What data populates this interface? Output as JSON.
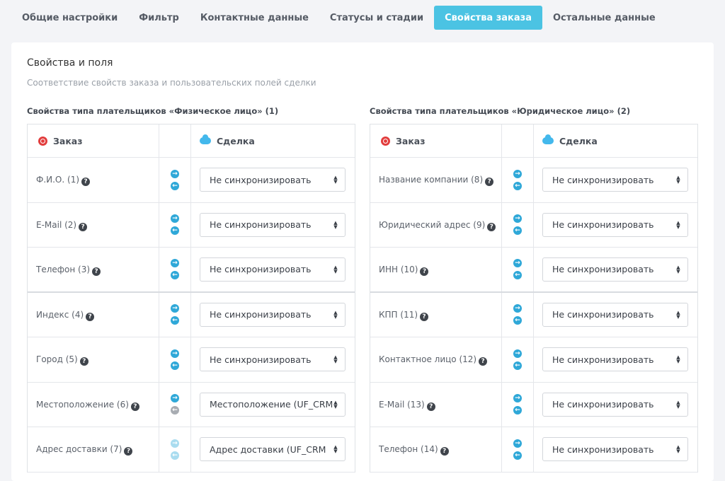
{
  "tabs": [
    {
      "label": "Общие настройки",
      "active": false
    },
    {
      "label": "Фильтр",
      "active": false
    },
    {
      "label": "Контактные данные",
      "active": false
    },
    {
      "label": "Статусы и стадии",
      "active": false
    },
    {
      "label": "Свойства заказа",
      "active": true
    },
    {
      "label": "Остальные данные",
      "active": false
    }
  ],
  "card": {
    "title": "Свойства и поля",
    "subtitle": "Соответствие свойств заказа и пользовательских полей сделки"
  },
  "colors": {
    "accent": "#4bc3e3",
    "arrow": "#2fa8d8"
  },
  "groups": [
    {
      "title": "Свойства типа плательщиков «Физическое лицо» (1)",
      "header": {
        "order": "Заказ",
        "deal": "Сделка",
        "order_icon": "bitrix-logo-icon",
        "deal_icon": "cloud-icon"
      },
      "rows": [
        {
          "label": "Ф.И.О. (1)",
          "value": "Не синхронизировать",
          "arrows": "normal"
        },
        {
          "label": "E-Mail (2)",
          "value": "Не синхронизировать",
          "arrows": "normal"
        },
        {
          "label": "Телефон (3)",
          "value": "Не синхронизировать",
          "arrows": "normal"
        },
        {
          "label": "Индекс (4)",
          "value": "Не синхронизировать",
          "arrows": "normal"
        },
        {
          "label": "Город (5)",
          "value": "Не синхронизировать",
          "arrows": "normal"
        },
        {
          "label": "Местоположение (6)",
          "value": "Местоположение (UF_CRM",
          "arrows": "left-grey"
        },
        {
          "label": "Адрес доставки (7)",
          "value": "Адрес доставки (UF_CRM",
          "arrows": "faded"
        }
      ]
    },
    {
      "title": "Свойства типа плательщиков «Юридическое лицо» (2)",
      "header": {
        "order": "Заказ",
        "deal": "Сделка",
        "order_icon": "bitrix-logo-icon",
        "deal_icon": "cloud-icon"
      },
      "rows": [
        {
          "label": "Название компании (8)",
          "value": "Не синхронизировать",
          "arrows": "normal"
        },
        {
          "label": "Юридический адрес (9)",
          "value": "Не синхронизировать",
          "arrows": "normal"
        },
        {
          "label": "ИНН (10)",
          "value": "Не синхронизировать",
          "arrows": "normal"
        },
        {
          "label": "КПП (11)",
          "value": "Не синхронизировать",
          "arrows": "normal"
        },
        {
          "label": "Контактное лицо (12)",
          "value": "Не синхронизировать",
          "arrows": "normal"
        },
        {
          "label": "E-Mail (13)",
          "value": "Не синхронизировать",
          "arrows": "normal"
        },
        {
          "label": "Телефон (14)",
          "value": "Не синхронизировать",
          "arrows": "normal"
        }
      ]
    }
  ]
}
